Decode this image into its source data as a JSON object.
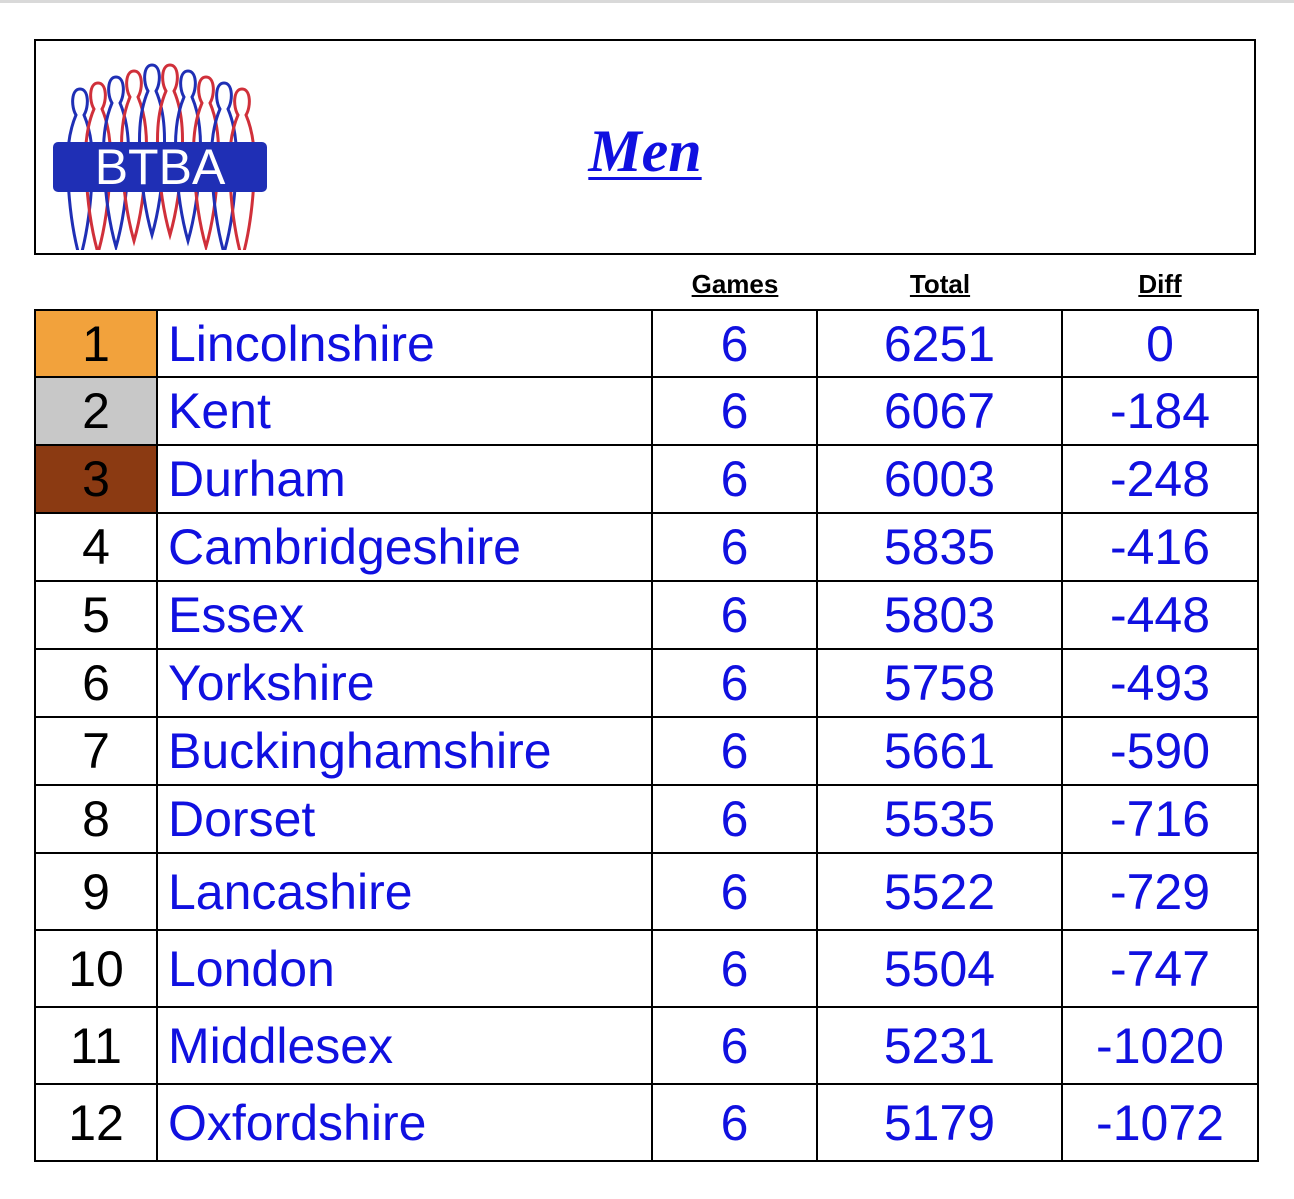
{
  "header": {
    "logo_text": "BTBA",
    "title": "Men"
  },
  "columns": {
    "games": "Games",
    "total": "Total",
    "diff": "Diff"
  },
  "rows": [
    {
      "pos": "1",
      "county": "Lincolnshire",
      "games": "6",
      "total": "6251",
      "diff": "0"
    },
    {
      "pos": "2",
      "county": "Kent",
      "games": "6",
      "total": "6067",
      "diff": "-184"
    },
    {
      "pos": "3",
      "county": "Durham",
      "games": "6",
      "total": "6003",
      "diff": "-248"
    },
    {
      "pos": "4",
      "county": "Cambridgeshire",
      "games": "6",
      "total": "5835",
      "diff": "-416"
    },
    {
      "pos": "5",
      "county": "Essex",
      "games": "6",
      "total": "5803",
      "diff": "-448"
    },
    {
      "pos": "6",
      "county": "Yorkshire",
      "games": "6",
      "total": "5758",
      "diff": "-493"
    },
    {
      "pos": "7",
      "county": "Buckinghamshire",
      "games": "6",
      "total": "5661",
      "diff": "-590"
    },
    {
      "pos": "8",
      "county": "Dorset",
      "games": "6",
      "total": "5535",
      "diff": "-716"
    },
    {
      "pos": "9",
      "county": "Lancashire",
      "games": "6",
      "total": "5522",
      "diff": "-729"
    },
    {
      "pos": "10",
      "county": "London",
      "games": "6",
      "total": "5504",
      "diff": "-747"
    },
    {
      "pos": "11",
      "county": "Middlesex",
      "games": "6",
      "total": "5231",
      "diff": "-1020"
    },
    {
      "pos": "12",
      "county": "Oxfordshire",
      "games": "6",
      "total": "5179",
      "diff": "-1072"
    }
  ],
  "colors": {
    "link_blue": "#1010e0",
    "gold": "#f2a23c",
    "silver": "#c8c8c8",
    "bronze": "#8b3a12",
    "logo_blue": "#1f2fb5",
    "logo_red": "#d0303a"
  }
}
